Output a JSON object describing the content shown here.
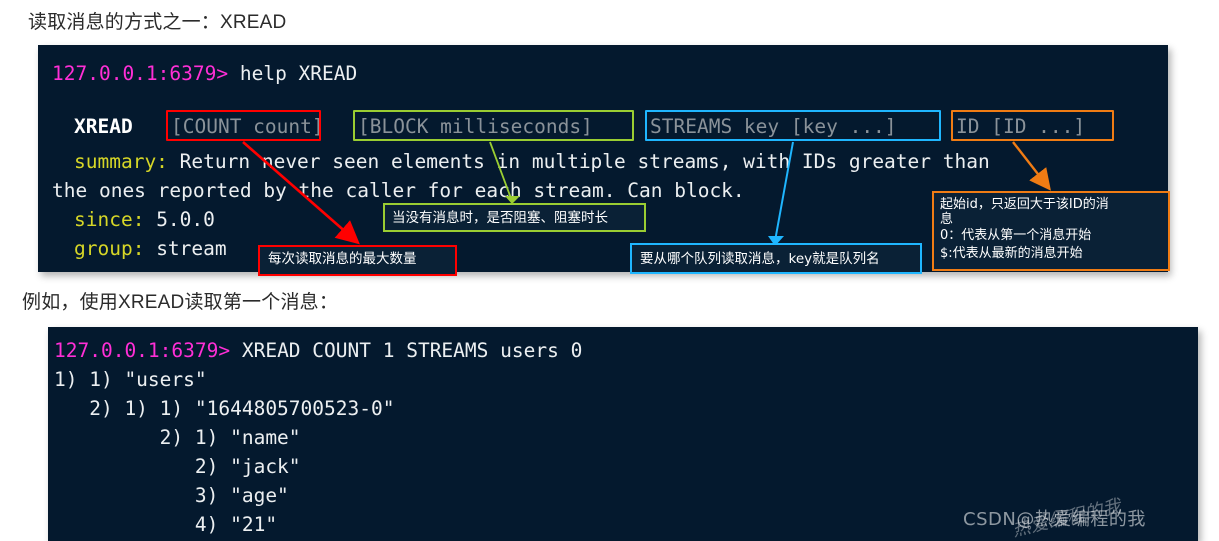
{
  "headings": {
    "line1": "读取消息的方式之一：XREAD",
    "line2": "例如，使用XREAD读取第一个消息："
  },
  "terminal1": {
    "prompt": "127.0.0.1:6379>",
    "command": " help XREAD",
    "syntax": {
      "cmd": "XREAD",
      "count": "[COUNT count]",
      "block": "[BLOCK milliseconds]",
      "streams": "STREAMS key [key ...]",
      "id": "ID [ID ...]"
    },
    "summary_label": "summary:",
    "summary_line1": " Return never seen elements in multiple streams, with IDs greater than",
    "summary_line2": "the ones reported by the caller for each stream. Can block.",
    "since_label": "since:",
    "since_value": " 5.0.0",
    "group_label": "group:",
    "group_value": " stream"
  },
  "callouts": {
    "count": "每次读取消息的最大数量",
    "block": "当没有消息时，是否阻塞、阻塞时长",
    "streams": "要从哪个队列读取消息，key就是队列名",
    "id_line1": "起始id，只返回大于该ID的消",
    "id_line2": "息",
    "id_line3": "0：代表从第一个消息开始",
    "id_line4": "$:代表从最新的消息开始"
  },
  "colors": {
    "count_box": "#ff0000",
    "block_box": "#9acd32",
    "streams_box": "#1fb6ff",
    "id_box": "#f07c14",
    "terminal_bg": "#04192e",
    "prompt": "#ff2fd6",
    "label_yellow": "#d6d627",
    "arg_gray": "#8a9299"
  },
  "terminal2": {
    "prompt": "127.0.0.1:6379>",
    "command": " XREAD COUNT 1 STREAMS users 0",
    "output": [
      "1) 1) \"users\"",
      "   2) 1) 1) \"1644805700523-0\"",
      "         2) 1) \"name\"",
      "            2) \"jack\"",
      "            3) \"age\"",
      "            4) \"21\""
    ]
  },
  "watermark": {
    "text": "CSDN@热爱编程的我",
    "ghost": "热爱编程的我"
  }
}
